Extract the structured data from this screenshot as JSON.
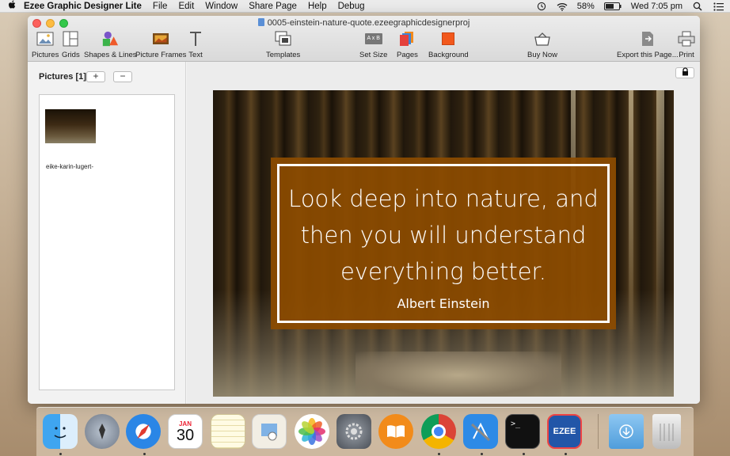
{
  "menubar": {
    "apple": "",
    "app_name": "Ezee Graphic Designer Lite",
    "items": [
      "File",
      "Edit",
      "Window",
      "Share Page",
      "Help",
      "Debug"
    ],
    "battery": "58%",
    "clock": "Wed 7:05 pm"
  },
  "window": {
    "title": "0005-einstein-nature-quote.ezeegraphicdesignerproj"
  },
  "toolbar": {
    "pictures": "Pictures",
    "grids": "Grids",
    "shapes": "Shapes & Lines",
    "frames": "Picture Frames",
    "text": "Text",
    "templates": "Templates",
    "set_size": "Set Size",
    "pages": "Pages",
    "background": "Background",
    "buy_now": "Buy Now",
    "export": "Export this Page...",
    "print": "Print",
    "set_size_icon_text": "A x B"
  },
  "pictures_panel": {
    "title": "Pictures [1]",
    "add": "+",
    "remove": "−",
    "items": [
      {
        "label": "eike-karin-lugert-"
      }
    ]
  },
  "design": {
    "quote": [
      "Look deep into nature, and",
      "then you will understand",
      "everything better."
    ],
    "author": "Albert Einstein",
    "box_color": "#8c4b00"
  },
  "dock": {
    "calendar_month": "JAN",
    "calendar_day": "30",
    "ezee_label": "EZEE",
    "terminal_prompt": ">_"
  }
}
